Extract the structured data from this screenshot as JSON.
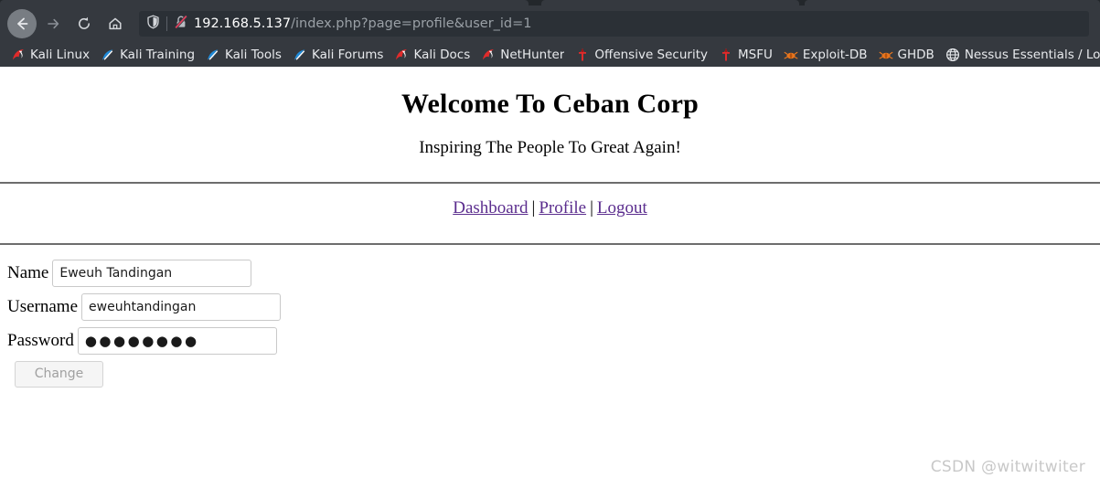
{
  "browser": {
    "toolbar": {
      "back_icon": "arrow-left-icon",
      "forward_icon": "arrow-right-icon",
      "reload_icon": "reload-icon",
      "home_icon": "home-icon"
    },
    "urlbar": {
      "shield_icon": "shield-icon",
      "security_icon": "padlock-crossed-insecure-icon",
      "host": "192.168.5.137",
      "path": "/index.php?page=profile&user_id=1",
      "full_url": "192.168.5.137/index.php?page=profile&user_id=1"
    },
    "bookmarks": [
      {
        "label": "Kali Linux",
        "icon": "kali-dragon-red-icon"
      },
      {
        "label": "Kali Training",
        "icon": "kali-sword-blue-icon"
      },
      {
        "label": "Kali Tools",
        "icon": "kali-sword-blue-icon"
      },
      {
        "label": "Kali Forums",
        "icon": "kali-sword-blue-icon"
      },
      {
        "label": "Kali Docs",
        "icon": "kali-dragon-red-icon"
      },
      {
        "label": "NetHunter",
        "icon": "kali-dragon-red-icon"
      },
      {
        "label": "Offensive Security",
        "icon": "dagger-red-icon"
      },
      {
        "label": "MSFU",
        "icon": "dagger-red-icon"
      },
      {
        "label": "Exploit-DB",
        "icon": "bug-orange-icon"
      },
      {
        "label": "GHDB",
        "icon": "bug-orange-icon"
      },
      {
        "label": "Nessus Essentials / Log…",
        "icon": "globe-icon"
      }
    ]
  },
  "page": {
    "title": "Welcome To Ceban Corp",
    "tagline": "Inspiring The People To Great Again!",
    "nav": {
      "dashboard": "Dashboard",
      "profile": "Profile",
      "logout": "Logout",
      "separator": "|"
    },
    "form": {
      "name_label": "Name",
      "name_value": "Eweuh Tandingan",
      "username_label": "Username",
      "username_value": "eweuhtandingan",
      "password_label": "Password",
      "password_value": "●●●●●●●●",
      "submit_label": "Change"
    },
    "watermark": "CSDN @witwitwiter"
  },
  "colors": {
    "chrome_bg": "#35393f",
    "urlbar_bg": "#2b3036",
    "link_purple": "#5b2d8e",
    "kali_red": "#e02b2b",
    "kali_blue": "#1f8ad8",
    "bug_orange": "#e8761e"
  }
}
